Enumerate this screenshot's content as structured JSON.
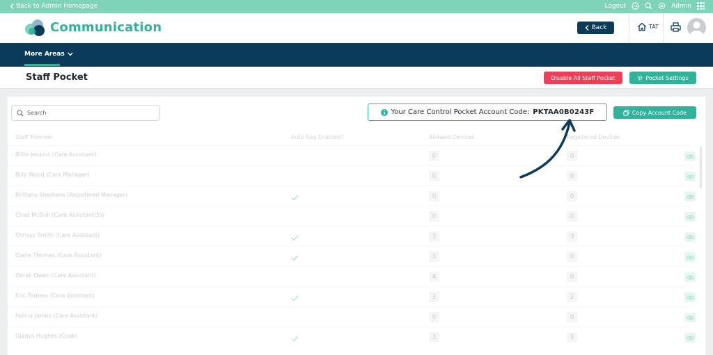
{
  "topbar": {
    "back_label": "Back to Admin Homepage",
    "logout_label": "Logout",
    "user_label": "Admin"
  },
  "header": {
    "app_title": "Communication",
    "back_button": "Back",
    "home_label": "TAT"
  },
  "nav": {
    "more_areas": "More Areas"
  },
  "titlebar": {
    "title": "Staff Pocket",
    "disable_button": "Disable All Staff Pocket",
    "settings_button": "Pocket Settings"
  },
  "toolbar": {
    "search_placeholder": "Search",
    "account_code_label": "Your Care Control Pocket Account Code:",
    "account_code": "PKTAA0B0243F",
    "copy_button": "Copy Account Code"
  },
  "table": {
    "columns": [
      "Staff Member",
      "Auto Reg Enabled?",
      "Allowed Devices",
      "Registered Devices"
    ],
    "rows": [
      {
        "name": "Billie Jenkins (Care Assistant)",
        "auto_reg": false,
        "allowed": "0",
        "registered": "0"
      },
      {
        "name": "Billy Wood (Care Manager)",
        "auto_reg": false,
        "allowed": "0",
        "registered": "0"
      },
      {
        "name": "Brittany Stephens (Registered Manager)",
        "auto_reg": true,
        "allowed": "0",
        "registered": "0"
      },
      {
        "name": "Chad McDoll (Care Assistant(5))",
        "auto_reg": false,
        "allowed": "0",
        "registered": "0"
      },
      {
        "name": "Chrissy Smith (Care Assistant)",
        "auto_reg": true,
        "allowed": "3",
        "registered": "3"
      },
      {
        "name": "Claire Thomas (Care Assistant)",
        "auto_reg": true,
        "allowed": "3",
        "registered": "0"
      },
      {
        "name": "Derek Owen (Care Assistant)",
        "auto_reg": false,
        "allowed": "4",
        "registered": "0"
      },
      {
        "name": "Eric Tierney (Care Assistant)",
        "auto_reg": true,
        "allowed": "3",
        "registered": "2"
      },
      {
        "name": "Felicia James (Care Assistant)",
        "auto_reg": false,
        "allowed": "0",
        "registered": "0"
      },
      {
        "name": "Gladys Hughes (Cook)",
        "auto_reg": true,
        "allowed": "3",
        "registered": "3"
      }
    ]
  },
  "colors": {
    "teal": "#2fb39b",
    "mint": "#7fd3b9",
    "navy": "#0b3b58",
    "red": "#ef3e56"
  },
  "icons": [
    "chevron-left-icon",
    "logout-icon",
    "search-icon",
    "gear-icon",
    "grid-icon",
    "home-icon",
    "printer-icon",
    "info-icon",
    "copy-icon",
    "check-icon",
    "eye-icon",
    "curved-arrow-icon"
  ]
}
